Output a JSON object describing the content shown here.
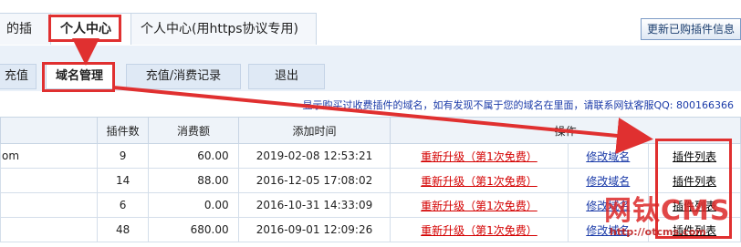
{
  "top_tabs": [
    {
      "label": "的插件"
    },
    {
      "label": "个人中心"
    },
    {
      "label": "个人中心(用https协议专用)"
    }
  ],
  "update_button": "更新已购插件信息",
  "sub_tabs": [
    {
      "label": "充值"
    },
    {
      "label": "域名管理"
    },
    {
      "label": "充值/消费记录"
    },
    {
      "label": "退出"
    }
  ],
  "notice": "显示购买过收费插件的域名，如有发现不属于您的域名在里面，请联系网钛客服QQ: 800166366",
  "table": {
    "headers": [
      "",
      "插件数",
      "消费额",
      "添加时间",
      "操作"
    ],
    "rows": [
      {
        "domain": "om",
        "count": "9",
        "amount": "60.00",
        "time": "2019-02-08 12:53:21",
        "upgrade": "重新升级（第1次免费）",
        "edit": "修改域名",
        "list": "插件列表"
      },
      {
        "domain": "",
        "count": "14",
        "amount": "88.00",
        "time": "2016-12-05 17:08:02",
        "upgrade": "重新升级（第1次免费）",
        "edit": "修改域名",
        "list": "插件列表"
      },
      {
        "domain": "",
        "count": "6",
        "amount": "0.00",
        "time": "2016-10-31 14:33:09",
        "upgrade": "重新升级（第1次免费）",
        "edit": "修改域名",
        "list": "插件列表"
      },
      {
        "domain": "",
        "count": "48",
        "amount": "680.00",
        "time": "2016-09-01 12:09:26",
        "upgrade": "重新升级（第1次免费）",
        "edit": "修改域名",
        "list": "插件列表"
      }
    ]
  },
  "watermark": {
    "brand": "网钛CMS",
    "url": "http://otcms.com"
  },
  "colors": {
    "highlight": "#e03030",
    "link_red": "#d40000",
    "link_blue": "#1a3aa8"
  }
}
